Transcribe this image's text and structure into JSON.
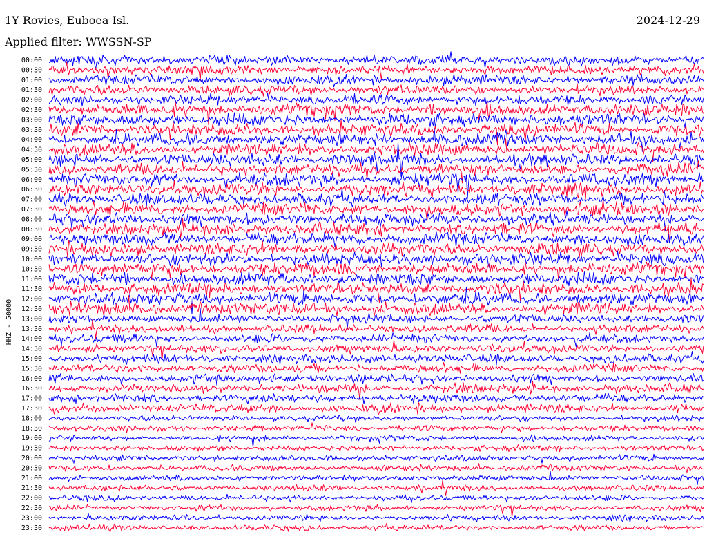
{
  "header": {
    "station": "1Y Rovies, Euboea Isl.",
    "date": "2024-12-29",
    "filter": "Applied filter: WWSSN-SP"
  },
  "chart_data": {
    "type": "line",
    "title": "1Y Rovies, Euboea Isl.",
    "subtitle": "Applied filter: WWSSN-SP",
    "ylabel": "HHZ - 50000",
    "xlabel": "",
    "y_tick_labels": [
      "00:00",
      "00:30",
      "01:00",
      "01:30",
      "02:00",
      "02:30",
      "03:00",
      "03:30",
      "04:00",
      "04:30",
      "05:00",
      "05:30",
      "06:00",
      "06:30",
      "07:00",
      "07:30",
      "08:00",
      "08:30",
      "09:00",
      "09:30",
      "10:00",
      "10:30",
      "11:00",
      "11:30",
      "12:00",
      "12:30",
      "13:00",
      "13:30",
      "14:00",
      "14:30",
      "15:00",
      "15:30",
      "16:00",
      "16:30",
      "17:00",
      "17:30",
      "18:00",
      "18:30",
      "19:00",
      "19:30",
      "20:00",
      "20:30",
      "21:00",
      "21:30",
      "22:00",
      "22:30",
      "23:00",
      "23:30"
    ],
    "trace_colors": [
      "#0000ff",
      "#ff0033"
    ],
    "color_pattern": "alternating by row",
    "grid": false,
    "legend": "none",
    "x_range_minutes": [
      0,
      30
    ]
  }
}
